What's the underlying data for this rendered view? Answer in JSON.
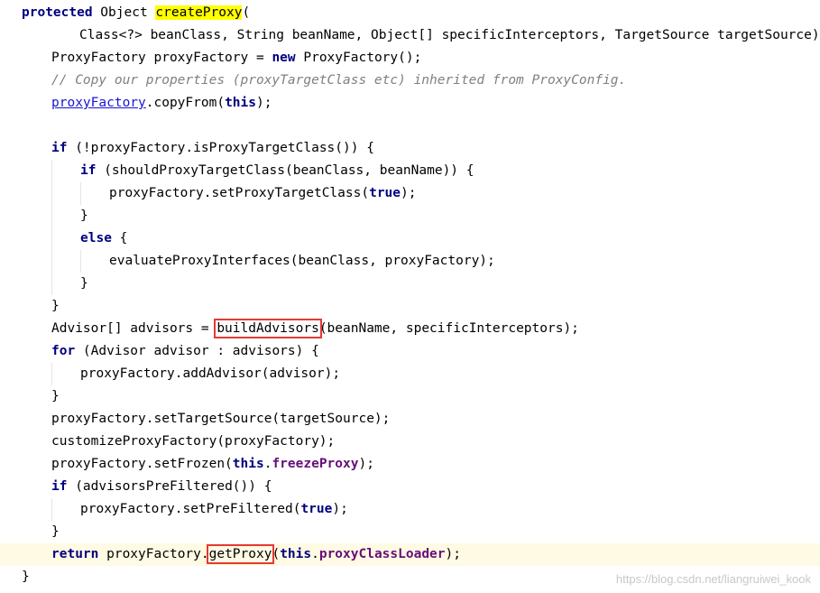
{
  "colors": {
    "keyword": "#000080",
    "comment": "#808080",
    "field": "#660e7a",
    "method_highlight": "#ffff00",
    "link": "#1515d6",
    "annotation_box": "#e53935",
    "current_line": "#fffae3"
  },
  "code": {
    "lines": [
      {
        "tokens": [
          {
            "t": "protected",
            "c": "kw"
          },
          {
            "t": " Object ",
            "c": "plain"
          },
          {
            "t": "createProxy",
            "c": "mhl"
          },
          {
            "t": "(",
            "c": "plain"
          }
        ]
      },
      {
        "tokens": [
          {
            "t": "Class<?> beanClass, String beanName, Object[] specificInterceptors, TargetSource targetSource) {",
            "c": "plain"
          }
        ]
      },
      {
        "tokens": [
          {
            "t": "ProxyFactory proxyFactory = ",
            "c": "plain"
          },
          {
            "t": "new",
            "c": "kw"
          },
          {
            "t": " ProxyFactory();",
            "c": "plain"
          }
        ]
      },
      {
        "tokens": [
          {
            "t": "// Copy our properties (proxyTargetClass etc) inherited from ProxyConfig.",
            "c": "cm"
          }
        ]
      },
      {
        "tokens": [
          {
            "t": "proxyFactory",
            "c": "lnk"
          },
          {
            "t": ".copyFrom(",
            "c": "plain"
          },
          {
            "t": "this",
            "c": "kw"
          },
          {
            "t": ");",
            "c": "plain"
          }
        ]
      },
      {
        "tokens": []
      },
      {
        "tokens": [
          {
            "t": "if",
            "c": "kw"
          },
          {
            "t": " (!proxyFactory.isProxyTargetClass()) {",
            "c": "plain"
          }
        ]
      },
      {
        "tokens": [
          {
            "t": "if",
            "c": "kw"
          },
          {
            "t": " (shouldProxyTargetClass(beanClass, beanName)) {",
            "c": "plain"
          }
        ]
      },
      {
        "tokens": [
          {
            "t": "proxyFactory.setProxyTargetClass(",
            "c": "plain"
          },
          {
            "t": "true",
            "c": "kw"
          },
          {
            "t": ");",
            "c": "plain"
          }
        ]
      },
      {
        "tokens": [
          {
            "t": "}",
            "c": "plain"
          }
        ]
      },
      {
        "tokens": [
          {
            "t": "else",
            "c": "kw"
          },
          {
            "t": " {",
            "c": "plain"
          }
        ]
      },
      {
        "tokens": [
          {
            "t": "evaluateProxyInterfaces(beanClass, proxyFactory);",
            "c": "plain"
          }
        ]
      },
      {
        "tokens": [
          {
            "t": "}",
            "c": "plain"
          }
        ]
      },
      {
        "tokens": [
          {
            "t": "}",
            "c": "plain"
          }
        ]
      },
      {
        "tokens": [
          {
            "t": "Advisor[] advisors = ",
            "c": "plain"
          },
          {
            "t": "buildAdvisors",
            "c": "box"
          },
          {
            "t": "(beanName, specificInterceptors);",
            "c": "plain"
          }
        ]
      },
      {
        "tokens": [
          {
            "t": "for",
            "c": "kw"
          },
          {
            "t": " (Advisor advisor : advisors) {",
            "c": "plain"
          }
        ]
      },
      {
        "tokens": [
          {
            "t": "proxyFactory.addAdvisor(advisor);",
            "c": "plain"
          }
        ]
      },
      {
        "tokens": [
          {
            "t": "}",
            "c": "plain"
          }
        ]
      },
      {
        "tokens": [
          {
            "t": "proxyFactory.setTargetSource(targetSource);",
            "c": "plain"
          }
        ]
      },
      {
        "tokens": [
          {
            "t": "customizeProxyFactory(proxyFactory);",
            "c": "plain"
          }
        ]
      },
      {
        "tokens": [
          {
            "t": "proxyFactory.setFrozen(",
            "c": "plain"
          },
          {
            "t": "this",
            "c": "kw"
          },
          {
            "t": ".",
            "c": "plain"
          },
          {
            "t": "freezeProxy",
            "c": "fld"
          },
          {
            "t": ");",
            "c": "plain"
          }
        ]
      },
      {
        "tokens": [
          {
            "t": "if",
            "c": "kw"
          },
          {
            "t": " (advisorsPreFiltered()) {",
            "c": "plain"
          }
        ]
      },
      {
        "tokens": [
          {
            "t": "proxyFactory.setPreFiltered(",
            "c": "plain"
          },
          {
            "t": "true",
            "c": "kw"
          },
          {
            "t": ");",
            "c": "plain"
          }
        ]
      },
      {
        "tokens": [
          {
            "t": "}",
            "c": "plain"
          }
        ]
      },
      {
        "tokens": [
          {
            "t": "return",
            "c": "kw"
          },
          {
            "t": " proxyFactory.",
            "c": "plain"
          },
          {
            "t": "getProxy",
            "c": "box"
          },
          {
            "t": "(",
            "c": "plain"
          },
          {
            "t": "this",
            "c": "kw"
          },
          {
            "t": ".",
            "c": "plain"
          },
          {
            "t": "proxyClassLoader",
            "c": "fld"
          },
          {
            "t": ");",
            "c": "plain"
          }
        ]
      },
      {
        "tokens": [
          {
            "t": "}",
            "c": "plain"
          }
        ]
      }
    ]
  },
  "watermark": "https://blog.csdn.net/liangruiwei_kook"
}
